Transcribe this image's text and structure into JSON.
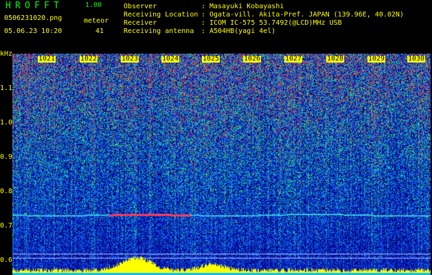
{
  "header": {
    "app_title": "HROFFT",
    "version": "1.00",
    "file_name": "0506231020.png",
    "datetime": "05.06.23 10:20",
    "meteor_label": "meteor",
    "meteor_count": "41"
  },
  "info": [
    {
      "label": "Observer",
      "value": "Masayuki Kobayashi"
    },
    {
      "label": "Receiving Location",
      "value": "Ogata-vill. Akita-Pref. JAPAN (139.96E, 40.02N)"
    },
    {
      "label": "Receiver",
      "value": "ICOM IC-575 53.7492(@LCD)MHz USB"
    },
    {
      "label": "Receiving antenna",
      "value": "A504HB(yagi 4el)"
    }
  ],
  "info_separator": ":",
  "y_axis": {
    "unit": "kHz",
    "ticks": [
      "1.1",
      "1.0",
      "0.9",
      "0.8",
      "0.7",
      "0.6"
    ]
  },
  "x_axis": {
    "ticks": [
      "1021",
      "1022",
      "1023",
      "1024",
      "1025",
      "1026",
      "1027",
      "1028",
      "1029",
      "1030"
    ]
  },
  "colors": {
    "background": "#000000",
    "text": "#ffff00",
    "title": "#00ff00",
    "spectrum": "#ffff00",
    "meteor_trace": "#ff3030",
    "noise_low": "#0000a0",
    "noise_mid": "#1060ff",
    "noise_high": "#20c0a0"
  }
}
